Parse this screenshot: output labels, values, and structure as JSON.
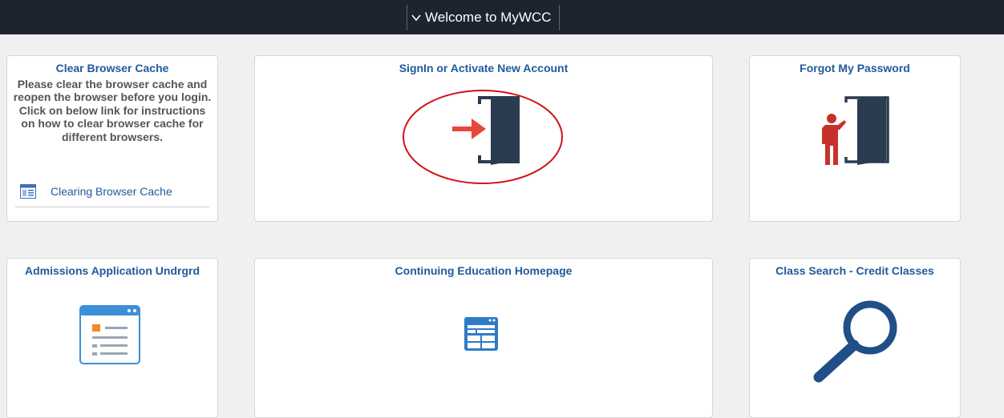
{
  "header": {
    "title": "Welcome to MyWCC",
    "chevron_icon": "chevron-down-icon"
  },
  "tiles": {
    "clear_cache": {
      "title": "Clear Browser Cache",
      "body": "Please clear the browser cache and reopen the browser before you login. Click on below link for instructions on how to clear browser cache for different browsers.",
      "link_label": "Clearing Browser Cache",
      "link_icon": "web-page-icon"
    },
    "signin": {
      "title": "SignIn or Activate New Account",
      "icon": "door-enter-icon",
      "highlight_color": "#d0101a"
    },
    "forgot_password": {
      "title": "Forgot My Password",
      "icon": "person-door-icon"
    },
    "admissions": {
      "title": "Admissions Application Undrgrd",
      "icon": "application-form-icon"
    },
    "continuing_ed": {
      "title": "Continuing Education Homepage",
      "icon": "homepage-layout-icon"
    },
    "class_search": {
      "title": "Class Search - Credit Classes",
      "icon": "magnifier-icon"
    }
  },
  "colors": {
    "header_bg": "#1c2430",
    "tile_title": "#1f5a9c",
    "icon_navy": "#2b3b50",
    "icon_red": "#e8473c",
    "icon_blue": "#3d8fd8"
  }
}
